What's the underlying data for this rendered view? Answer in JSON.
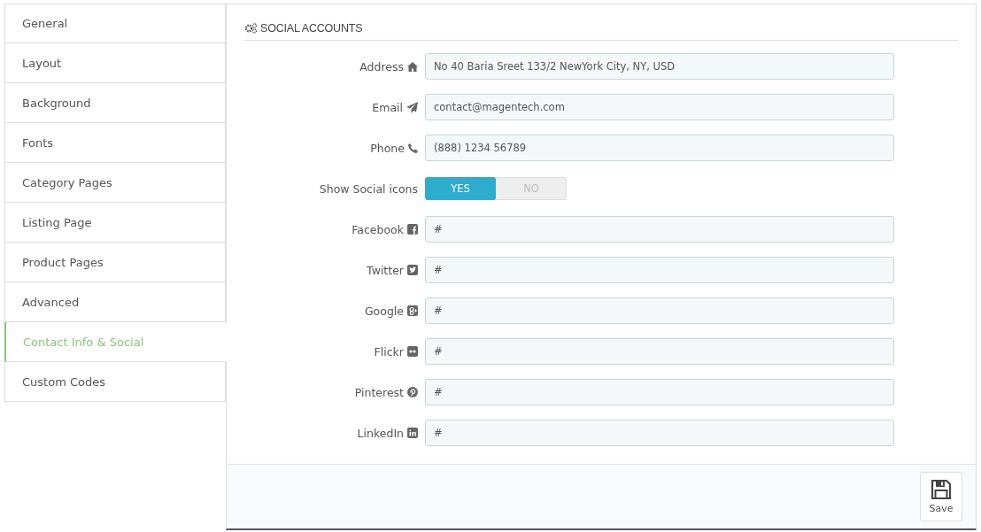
{
  "sidebar": {
    "items": [
      {
        "label": "General",
        "selected": false
      },
      {
        "label": "Layout",
        "selected": false
      },
      {
        "label": "Background",
        "selected": false
      },
      {
        "label": "Fonts",
        "selected": false
      },
      {
        "label": "Category Pages",
        "selected": false
      },
      {
        "label": "Listing Page",
        "selected": false
      },
      {
        "label": "Product Pages",
        "selected": false
      },
      {
        "label": "Advanced",
        "selected": false
      },
      {
        "label": "Contact Info & Social",
        "selected": true
      },
      {
        "label": "Custom Codes",
        "selected": false
      }
    ]
  },
  "panel": {
    "title": "SOCIAL ACCOUNTS",
    "fields": [
      {
        "kind": "text",
        "label": "Address",
        "value": "No 40 Baria Sreet 133/2 NewYork City, NY, USD"
      },
      {
        "kind": "text",
        "label": "Email",
        "value": "contact@magentech.com"
      },
      {
        "kind": "text",
        "label": "Phone",
        "value": "(888) 1234 56789"
      },
      {
        "kind": "toggle",
        "label": "Show Social icons",
        "options": [
          {
            "label": "YES",
            "selected": true
          },
          {
            "label": "NO",
            "selected": false
          }
        ]
      },
      {
        "kind": "text",
        "label": "Facebook",
        "value": "#"
      },
      {
        "kind": "text",
        "label": "Twitter",
        "value": "#"
      },
      {
        "kind": "text",
        "label": "Google",
        "value": "#"
      },
      {
        "kind": "text",
        "label": "Flickr",
        "value": "#"
      },
      {
        "kind": "text",
        "label": "Pinterest",
        "value": "#"
      },
      {
        "kind": "text",
        "label": "LinkedIn",
        "value": "#"
      }
    ]
  },
  "footer": {
    "save_button": "Save"
  }
}
